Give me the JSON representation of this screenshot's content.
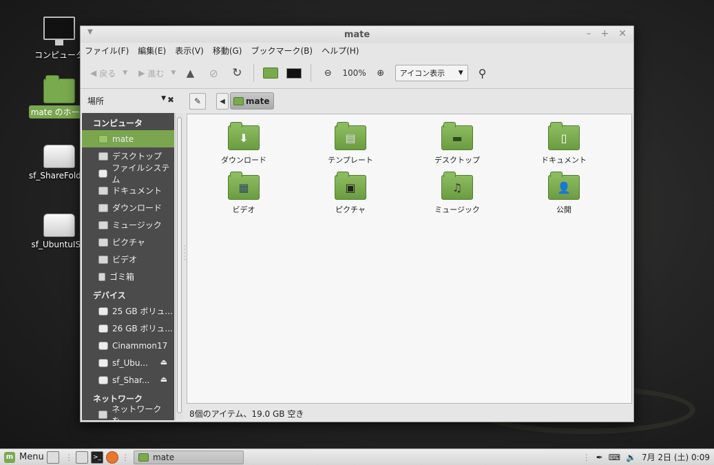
{
  "desktop": {
    "icons": [
      {
        "label": "コンピュータ"
      },
      {
        "label": "mate のホーム"
      },
      {
        "label": "sf_ShareFolder"
      },
      {
        "label": "sf_UbuntuISO"
      }
    ]
  },
  "window": {
    "title": "mate",
    "menu": [
      "ファイル(F)",
      "編集(E)",
      "表示(V)",
      "移動(G)",
      "ブックマーク(B)",
      "ヘルプ(H)"
    ],
    "toolbar": {
      "back_label": "戻る",
      "forward_label": "進む",
      "zoom_level": "100%",
      "view_mode": "アイコン表示"
    },
    "location": {
      "places_label": "場所",
      "crumb": "mate"
    },
    "sidebar": {
      "computer_header": "コンピュータ",
      "computer_items": [
        "mate",
        "デスクトップ",
        "ファイルシステム",
        "ドキュメント",
        "ダウンロード",
        "ミュージック",
        "ピクチャ",
        "ビデオ",
        "ゴミ箱"
      ],
      "devices_header": "デバイス",
      "device_items": [
        "25 GB ボリュ...",
        "26 GB ボリュ...",
        "Cinammon17",
        "sf_Ubu...",
        "sf_Shar..."
      ],
      "network_header": "ネットワーク",
      "network_items": [
        "ネットワークを..."
      ]
    },
    "files": [
      {
        "name": "ダウンロード",
        "icon": "download-icon"
      },
      {
        "name": "テンプレート",
        "icon": "template-icon"
      },
      {
        "name": "デスクトップ",
        "icon": "desktop-icon"
      },
      {
        "name": "ドキュメント",
        "icon": "document-icon"
      },
      {
        "name": "ビデオ",
        "icon": "video-icon"
      },
      {
        "name": "ピクチャ",
        "icon": "picture-icon"
      },
      {
        "name": "ミュージック",
        "icon": "music-icon"
      },
      {
        "name": "公開",
        "icon": "public-icon"
      }
    ],
    "status": "8個のアイテム、19.0 GB 空き"
  },
  "taskbar": {
    "menu_label": "Menu",
    "window_label": "mate",
    "clock": "7月 2日 (土) 0:09"
  },
  "colors": {
    "accent": "#7aa64f",
    "sidebar_bg": "#4b4b4b"
  }
}
